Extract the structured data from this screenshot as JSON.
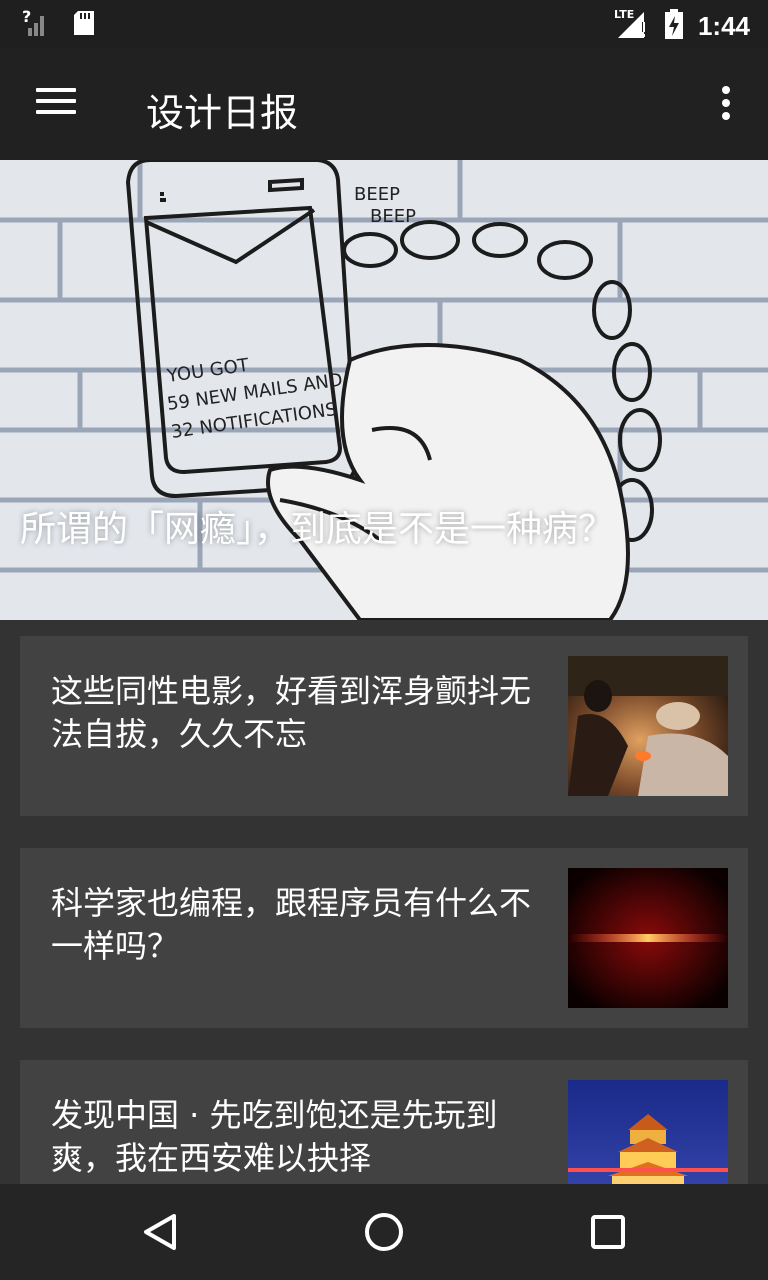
{
  "status_bar": {
    "time": "1:44",
    "network": "LTE",
    "signal_unknown": "?"
  },
  "toolbar": {
    "title": "设计日报"
  },
  "banner": {
    "title": "所谓的「网瘾」，到底是不是一种病？",
    "illustration_text": [
      "BEEP",
      "BEEP",
      "YOU GOT",
      "59 NEW MAILS AND",
      "32 NOTIFICATIONS"
    ],
    "dots_count": 5,
    "active_dot": 4
  },
  "stories": [
    {
      "title": "这些同性电影，好看到浑身颤抖无法自拔，久久不忘"
    },
    {
      "title": "科学家也编程，跟程序员有什么不一样吗？"
    },
    {
      "title": "发现中国 · 先吃到饱还是先玩到爽，我在西安难以抉择"
    }
  ],
  "colors": {
    "accent": "#ff1a66",
    "toolbar": "#212121",
    "card": "#424242",
    "background": "#333333"
  }
}
